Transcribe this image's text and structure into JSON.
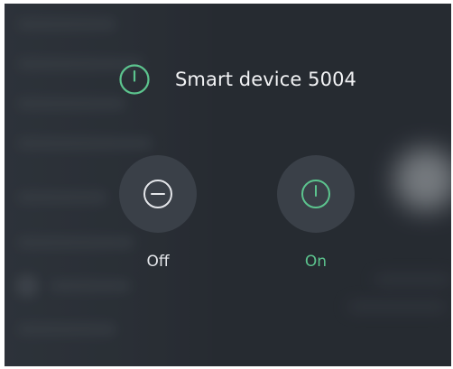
{
  "device": {
    "title": "Smart device 5004",
    "icon": "power-icon",
    "icon_color": "#5cc48e"
  },
  "actions": [
    {
      "label": "Off",
      "icon": "power-off-icon",
      "color": "#e4e6ea"
    },
    {
      "label": "On",
      "icon": "power-on-icon",
      "color": "#5cc48e"
    }
  ]
}
